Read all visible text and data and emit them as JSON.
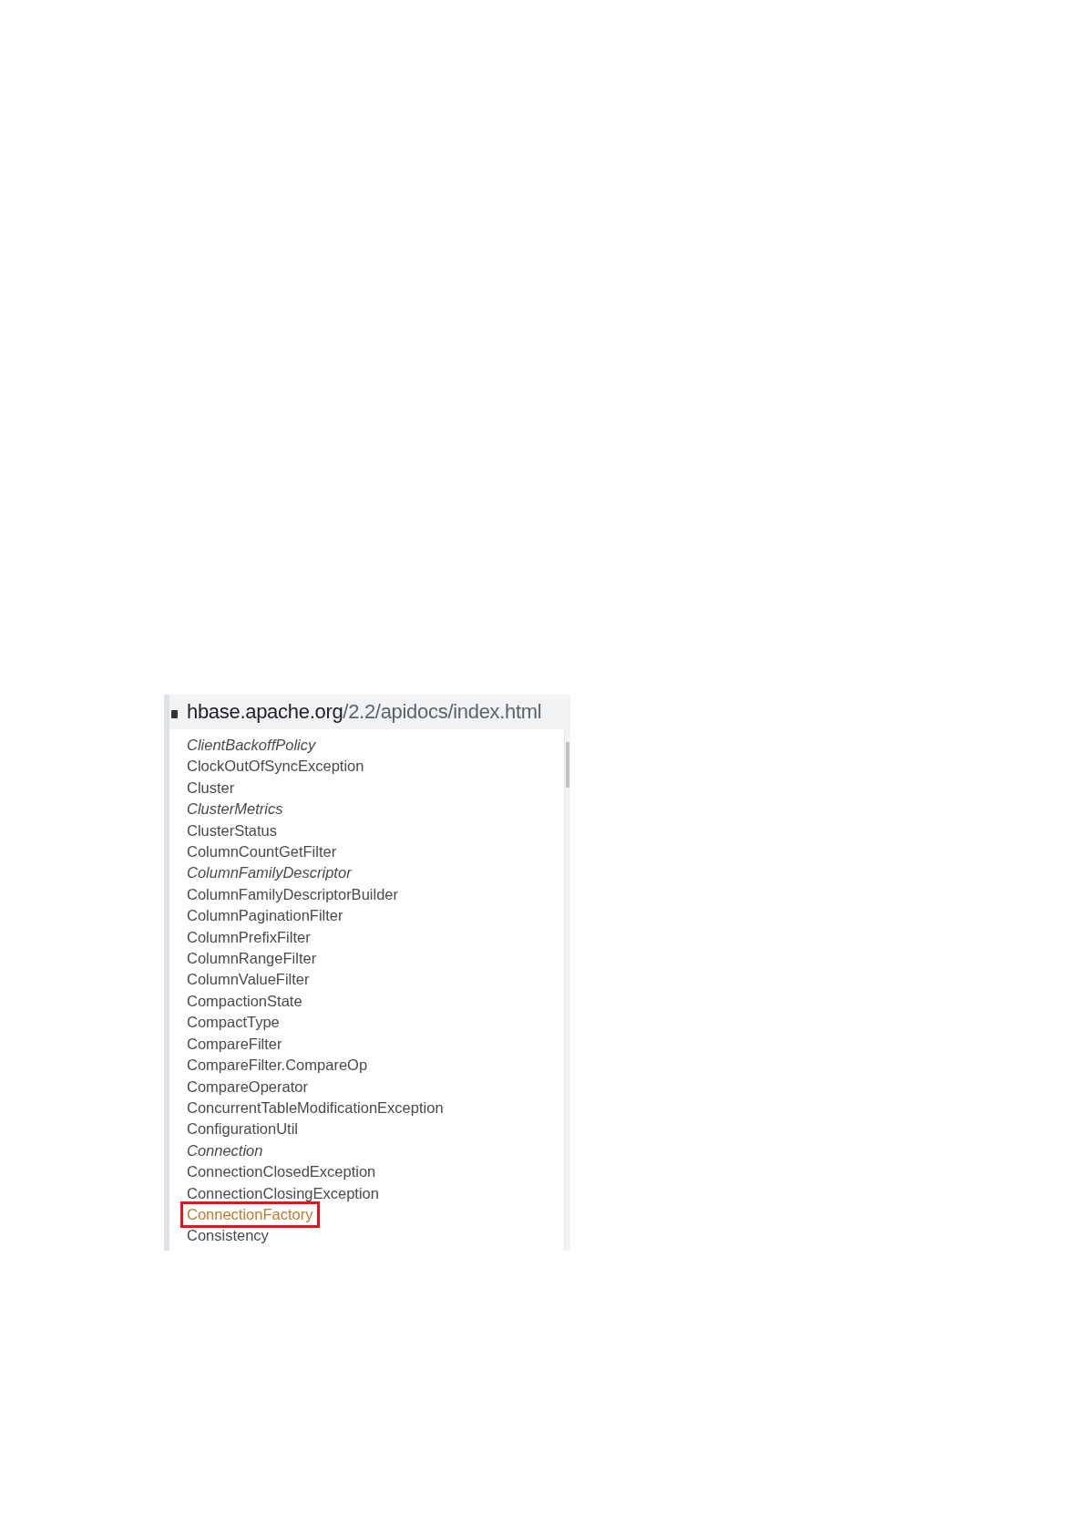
{
  "address_bar": {
    "host": "hbase.apache.org",
    "path": "/2.2/apidocs/index.html"
  },
  "class_list": [
    {
      "label": "ClientBackoffPolicy",
      "kind": "interface",
      "selected": false
    },
    {
      "label": "ClockOutOfSyncException",
      "kind": "class",
      "selected": false
    },
    {
      "label": "Cluster",
      "kind": "class",
      "selected": false
    },
    {
      "label": "ClusterMetrics",
      "kind": "interface",
      "selected": false
    },
    {
      "label": "ClusterStatus",
      "kind": "class",
      "selected": false
    },
    {
      "label": "ColumnCountGetFilter",
      "kind": "class",
      "selected": false
    },
    {
      "label": "ColumnFamilyDescriptor",
      "kind": "interface",
      "selected": false
    },
    {
      "label": "ColumnFamilyDescriptorBuilder",
      "kind": "class",
      "selected": false
    },
    {
      "label": "ColumnPaginationFilter",
      "kind": "class",
      "selected": false
    },
    {
      "label": "ColumnPrefixFilter",
      "kind": "class",
      "selected": false
    },
    {
      "label": "ColumnRangeFilter",
      "kind": "class",
      "selected": false
    },
    {
      "label": "ColumnValueFilter",
      "kind": "class",
      "selected": false
    },
    {
      "label": "CompactionState",
      "kind": "class",
      "selected": false
    },
    {
      "label": "CompactType",
      "kind": "class",
      "selected": false
    },
    {
      "label": "CompareFilter",
      "kind": "class",
      "selected": false
    },
    {
      "label": "CompareFilter.CompareOp",
      "kind": "class",
      "selected": false
    },
    {
      "label": "CompareOperator",
      "kind": "class",
      "selected": false
    },
    {
      "label": "ConcurrentTableModificationException",
      "kind": "class",
      "selected": false
    },
    {
      "label": "ConfigurationUtil",
      "kind": "class",
      "selected": false
    },
    {
      "label": "Connection",
      "kind": "interface",
      "selected": false
    },
    {
      "label": "ConnectionClosedException",
      "kind": "class",
      "selected": false
    },
    {
      "label": "ConnectionClosingException",
      "kind": "class",
      "selected": false
    },
    {
      "label": "ConnectionFactory",
      "kind": "class",
      "selected": true
    },
    {
      "label": "Consistency",
      "kind": "class",
      "selected": false
    }
  ]
}
